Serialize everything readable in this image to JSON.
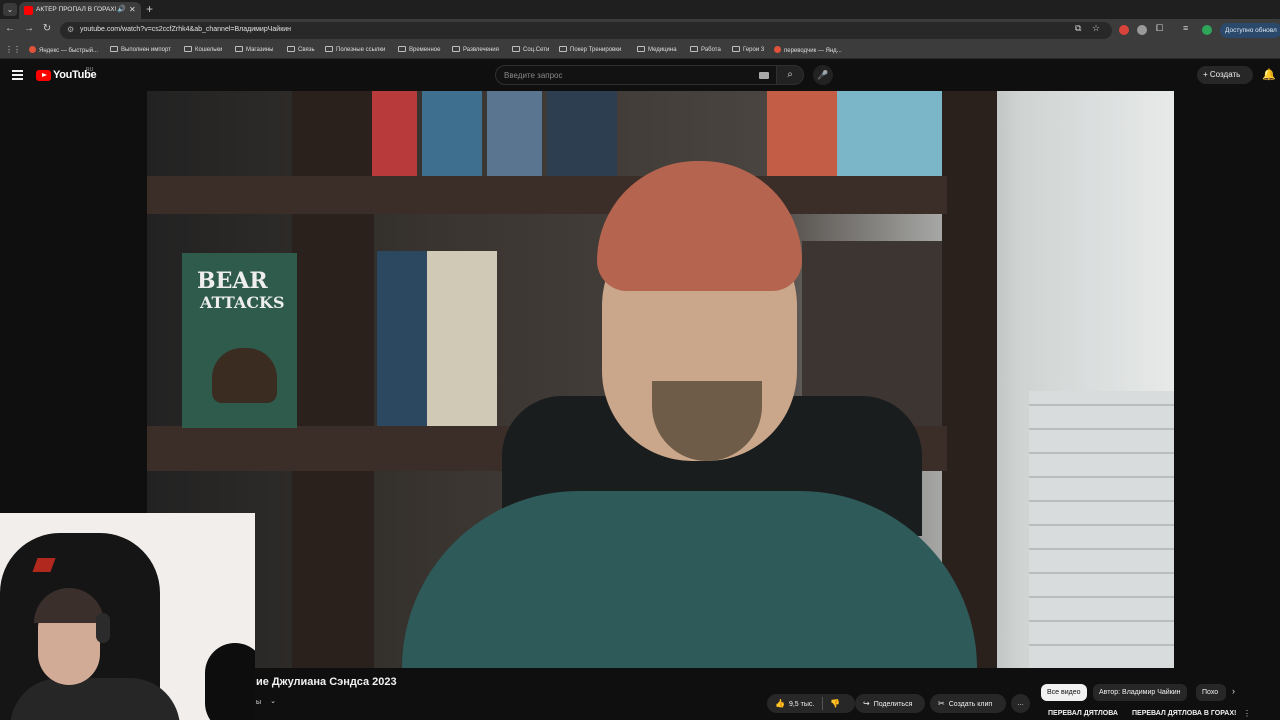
{
  "browser": {
    "tab_title": "АКТЁР ПРОПАЛ В ГОРАХ!",
    "tab_audio_icon": "speaker-icon",
    "url": "youtube.com/watch?v=cs2ccfZrhk4&ab_channel=ВладимирЧайкин",
    "update_button": "Доступно обновл",
    "bookmarks": [
      "Яндекс — быстрый...",
      "Выполнен импорт",
      "Кошельки",
      "Магазины",
      "Связь",
      "Полезные ссылки",
      "Временное",
      "Развлечения",
      "Соц.Сети",
      "Покер Тренировки",
      "Медицина",
      "Работа",
      "Герои 3",
      "переводчик — Янд..."
    ]
  },
  "youtube": {
    "logo_text": "YouTube",
    "region": "RU",
    "search_placeholder": "Введите запрос",
    "create_label": "Создать"
  },
  "video": {
    "book_title_1": "BEAR",
    "book_title_2": "ATTACKS",
    "title_fragment": "ие Джулиана Сэндса 2023",
    "channel_fragment": "ы"
  },
  "actions": {
    "likes": "9,5 тыс.",
    "share": "Поделиться",
    "clip": "Создать клип",
    "more": "…"
  },
  "chips": [
    "Все видео",
    "Автор: Владимир Чайкин",
    "Похо"
  ],
  "recommendations": [
    "ПЕРЕВАЛ ДЯТЛОВА",
    "ПЕРЕВАЛ ДЯТЛОВА В ГОРАХ!"
  ],
  "colors": {
    "youtube_red": "#ff0000",
    "background": "#0f0f0f",
    "chip": "#272727"
  }
}
